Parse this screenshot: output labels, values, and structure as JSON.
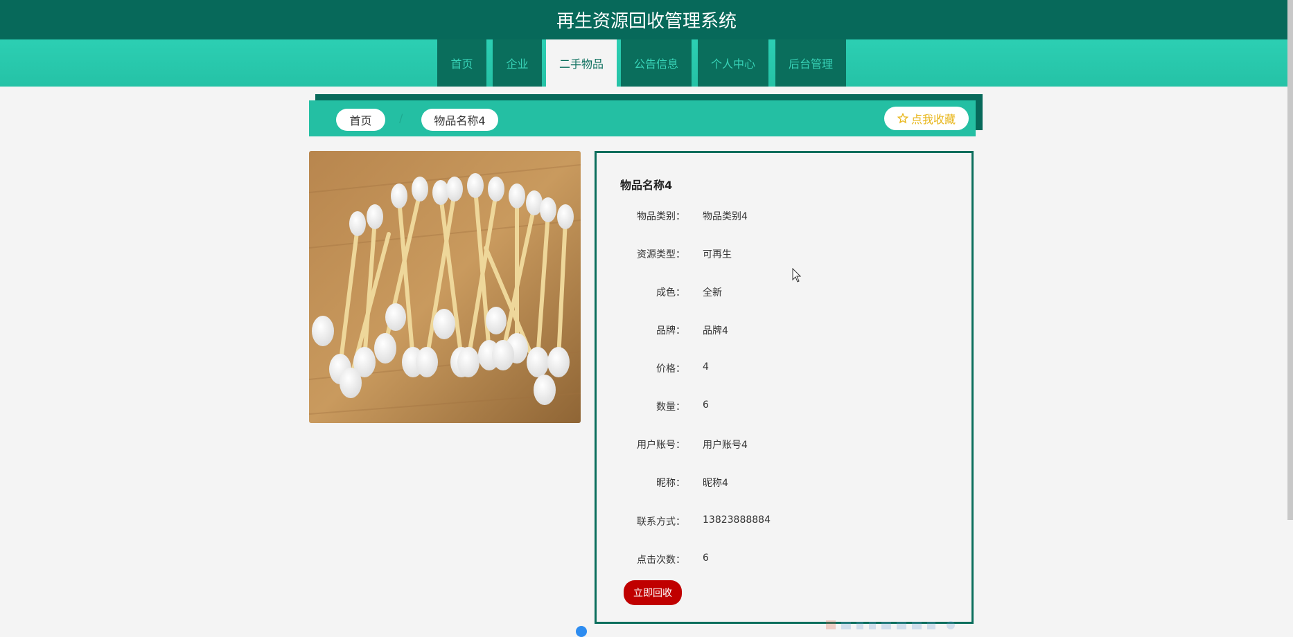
{
  "header": {
    "title": "再生资源回收管理系统"
  },
  "nav": {
    "items": [
      {
        "label": "首页"
      },
      {
        "label": "企业"
      },
      {
        "label": "二手物品"
      },
      {
        "label": "公告信息"
      },
      {
        "label": "个人中心"
      },
      {
        "label": "后台管理"
      }
    ],
    "active_index": 2
  },
  "breadcrumb": {
    "home": "首页",
    "current": "物品名称4",
    "favorite_label": "点我收藏"
  },
  "item": {
    "name": "物品名称4",
    "image_icon": "cotton-swabs-photo",
    "fields": [
      {
        "label": "物品类别：",
        "value": "物品类别4"
      },
      {
        "label": "资源类型：",
        "value": "可再生"
      },
      {
        "label": "成色：",
        "value": "全新"
      },
      {
        "label": "品牌：",
        "value": "品牌4"
      },
      {
        "label": "价格：",
        "value": "4"
      },
      {
        "label": "数量：",
        "value": "6"
      },
      {
        "label": "用户账号：",
        "value": "用户账号4"
      },
      {
        "label": "昵称：",
        "value": "昵称4"
      },
      {
        "label": "联系方式：",
        "value": "13823888884"
      },
      {
        "label": "点击次数：",
        "value": "6"
      }
    ],
    "action_label": "立即回收"
  },
  "colors": {
    "header_bg": "#07695a",
    "accent_teal": "#24bfa3",
    "nav_item_bg": "#0a6e5c",
    "action_red": "#c00000",
    "favorite_gold": "#e8b61a"
  }
}
